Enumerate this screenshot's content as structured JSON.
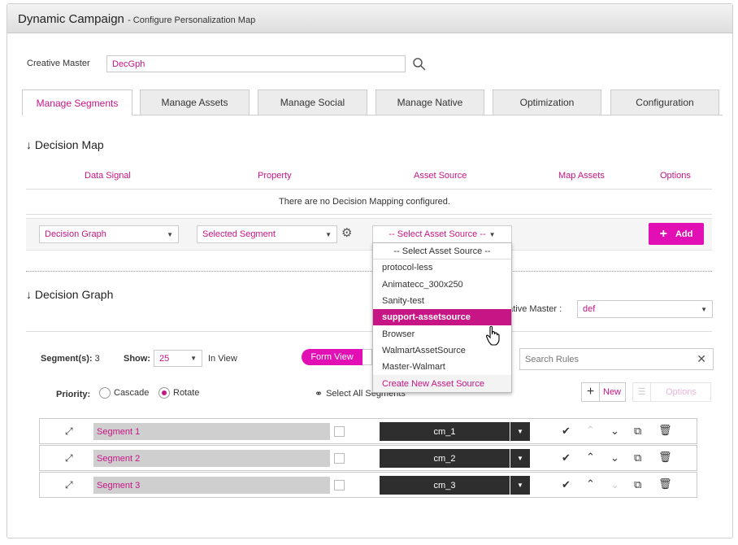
{
  "header": {
    "title": "Dynamic Campaign",
    "subtitle": "- Configure Personalization Map"
  },
  "creative_master": {
    "label": "Creative Master",
    "value": "DecGph"
  },
  "tabs": [
    {
      "label": "Manage Segments",
      "active": true
    },
    {
      "label": "Manage Assets"
    },
    {
      "label": "Manage Social"
    },
    {
      "label": "Manage Native"
    },
    {
      "label": "Optimization"
    },
    {
      "label": "Configuration"
    }
  ],
  "decision_map": {
    "title": "Decision Map",
    "columns": [
      "Data Signal",
      "Property",
      "Asset Source",
      "Map Assets",
      "Options"
    ],
    "empty_message": "There are no Decision Mapping configured.",
    "data_signal_value": "Decision Graph",
    "property_value": "Selected Segment",
    "asset_source_value": "-- Select Asset Source --",
    "add_label": "Add"
  },
  "asset_source_dropdown": {
    "options": [
      "-- Select Asset Source --",
      "protocol-less",
      "Animatecc_300x250",
      "Sanity-test",
      "support-assetsource",
      "Browser",
      "WalmartAssetSource",
      "Master-Walmart",
      "Create New Asset Source"
    ],
    "highlighted": "support-assetsource"
  },
  "decision_graph": {
    "title": "Decision Graph",
    "creative_master_label": "eative Master :",
    "creative_master_value": "def",
    "segments_label": "Segment(s):",
    "segments_count": "3",
    "show_label": "Show:",
    "show_value": "25",
    "in_view_label": "In View",
    "form_view_label": "Form View",
    "search_placeholder": "Search Rules",
    "priority_label": "Priority:",
    "cascade_label": "Cascade",
    "rotate_label": "Rotate",
    "priority_selected": "Rotate",
    "select_all_label": "Select All Segments",
    "new_label": "New",
    "options_label": "Options"
  },
  "segments": [
    {
      "name": "Segment 1",
      "cm": "cm_1"
    },
    {
      "name": "Segment 2",
      "cm": "cm_2"
    },
    {
      "name": "Segment 3",
      "cm": "cm_3"
    }
  ],
  "colors": {
    "accent": "#c71585",
    "button": "#e20fb4",
    "dark": "#2e2e2e"
  }
}
